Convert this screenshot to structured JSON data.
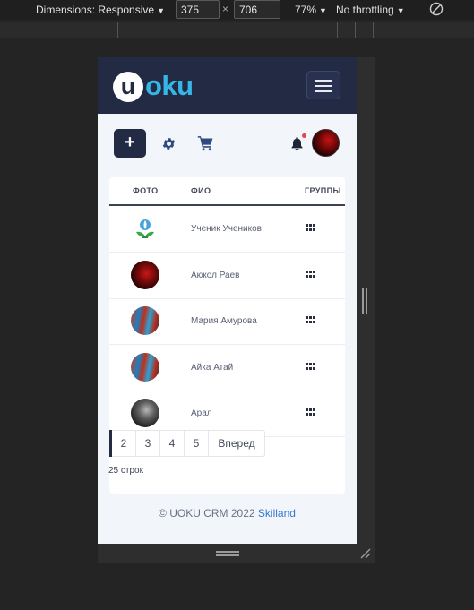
{
  "devtools": {
    "dimensions_label": "Dimensions: Responsive",
    "width_value": "375",
    "height_value": "706",
    "zoom_label": "77%",
    "throttle_label": "No throttling"
  },
  "header": {
    "logo_u": "u",
    "logo_text": "oku"
  },
  "actions": {
    "add_label": "+"
  },
  "table": {
    "headers": {
      "photo": "ФОТО",
      "name": "ФИО",
      "groups": "ГРУППЫ"
    },
    "rows": [
      {
        "name": "Ученик Учеников"
      },
      {
        "name": "Акжол Раев"
      },
      {
        "name": "Мария Амурова"
      },
      {
        "name": "Айка Атай"
      },
      {
        "name": "Арал"
      }
    ]
  },
  "pagination": {
    "pages": [
      "2",
      "3",
      "4",
      "5"
    ],
    "next_label": "Вперед"
  },
  "rows_count": "25 строк",
  "footer": {
    "text": "© UOKU CRM 2022",
    "link": "Skilland"
  },
  "colors": {
    "header_bg": "#222a44",
    "logo_accent": "#35b6e6",
    "page_bg": "#f2f5fa",
    "footer_link": "#3478d4",
    "notification_dot": "#e8424a"
  }
}
